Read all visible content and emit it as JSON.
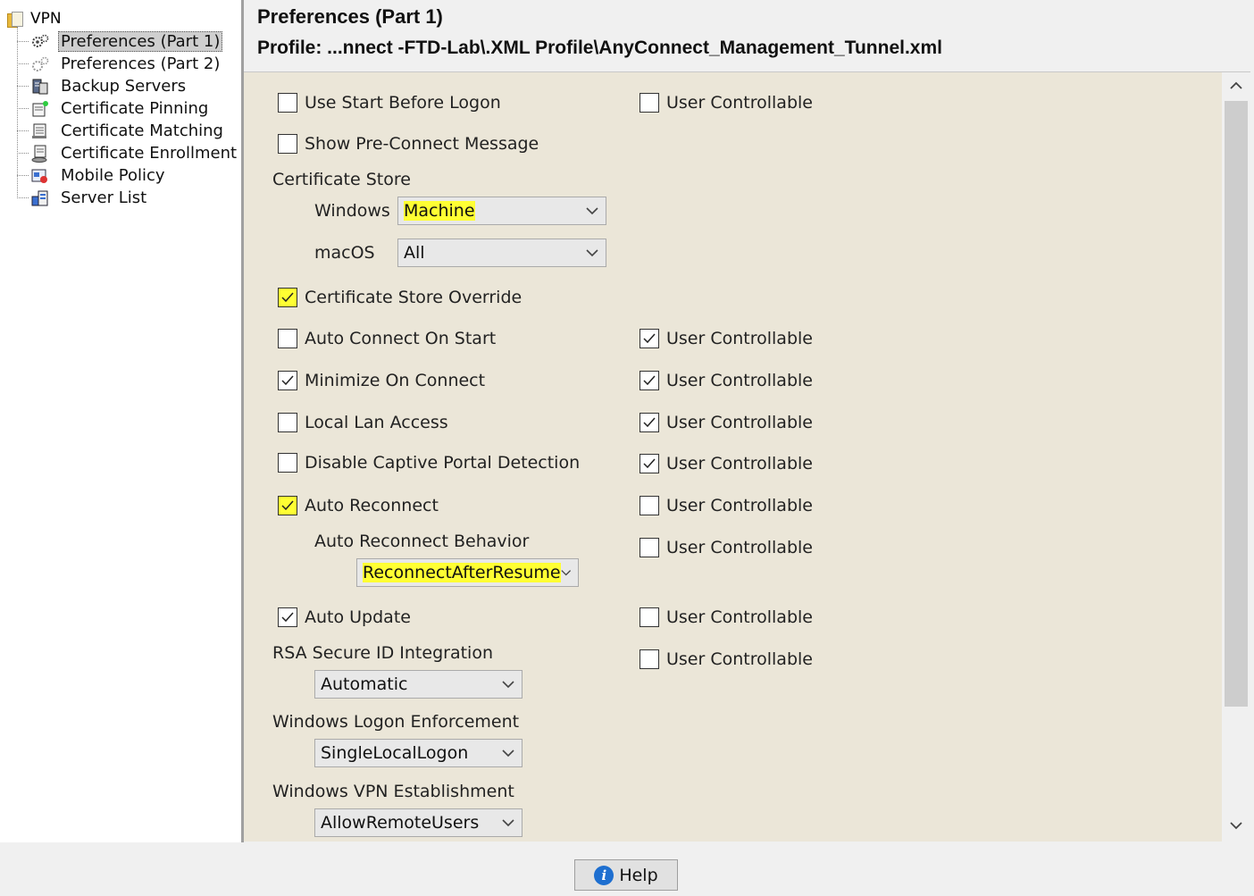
{
  "tree": {
    "root_label": "VPN",
    "items": [
      {
        "label": "Preferences (Part 1)",
        "icon": "gears-icon",
        "selected": true
      },
      {
        "label": "Preferences (Part 2)",
        "icon": "gears-gray-icon",
        "selected": false
      },
      {
        "label": "Backup Servers",
        "icon": "server-icon",
        "selected": false
      },
      {
        "label": "Certificate Pinning",
        "icon": "certificate-pin-icon",
        "selected": false
      },
      {
        "label": "Certificate Matching",
        "icon": "certificate-icon",
        "selected": false
      },
      {
        "label": "Certificate Enrollment",
        "icon": "certificate-enroll-icon",
        "selected": false
      },
      {
        "label": "Mobile Policy",
        "icon": "mobile-policy-icon",
        "selected": false
      },
      {
        "label": "Server List",
        "icon": "server-list-icon",
        "selected": false
      }
    ]
  },
  "header": {
    "title": "Preferences (Part 1)",
    "profile": "Profile:  ...nnect -FTD-Lab\\.XML Profile\\AnyConnect_Management_Tunnel.xml"
  },
  "prefs": {
    "use_start_before_logon": {
      "label": "Use Start Before Logon",
      "checked": false
    },
    "show_pre_connect_message": {
      "label": "Show Pre-Connect Message",
      "checked": false
    },
    "certificate_store": {
      "label": "Certificate Store",
      "windows_label": "Windows",
      "windows_value": "Machine",
      "macos_label": "macOS",
      "macos_value": "All"
    },
    "certificate_store_override": {
      "label": "Certificate Store Override",
      "checked": true
    },
    "auto_connect_on_start": {
      "label": "Auto Connect On Start",
      "checked": false
    },
    "minimize_on_connect": {
      "label": "Minimize On Connect",
      "checked": true
    },
    "local_lan_access": {
      "label": "Local Lan Access",
      "checked": false
    },
    "disable_captive_portal_detection": {
      "label": "Disable Captive Portal Detection",
      "checked": false
    },
    "auto_reconnect": {
      "label": "Auto Reconnect",
      "checked": true
    },
    "auto_reconnect_behavior": {
      "label": "Auto Reconnect Behavior",
      "value": "ReconnectAfterResume"
    },
    "auto_update": {
      "label": "Auto Update",
      "checked": true
    },
    "rsa_secure_id": {
      "label": "RSA Secure ID Integration",
      "value": "Automatic"
    },
    "windows_logon_enforcement": {
      "label": "Windows Logon Enforcement",
      "value": "SingleLocalLogon"
    },
    "windows_vpn_establishment": {
      "label": "Windows VPN Establishment",
      "value": "AllowRemoteUsers"
    }
  },
  "user_controllable": {
    "label": "User Controllable",
    "use_start_before_logon": false,
    "auto_connect_on_start": true,
    "minimize_on_connect": true,
    "local_lan_access": true,
    "disable_captive_portal_detection": true,
    "auto_reconnect": false,
    "auto_reconnect_behavior": false,
    "auto_update": false,
    "rsa_secure_id": false
  },
  "footer": {
    "help_label": "Help"
  },
  "colors": {
    "highlight": "#ffff33",
    "panel_bg": "#ebe6d8",
    "accent": "#1e6fd0"
  }
}
